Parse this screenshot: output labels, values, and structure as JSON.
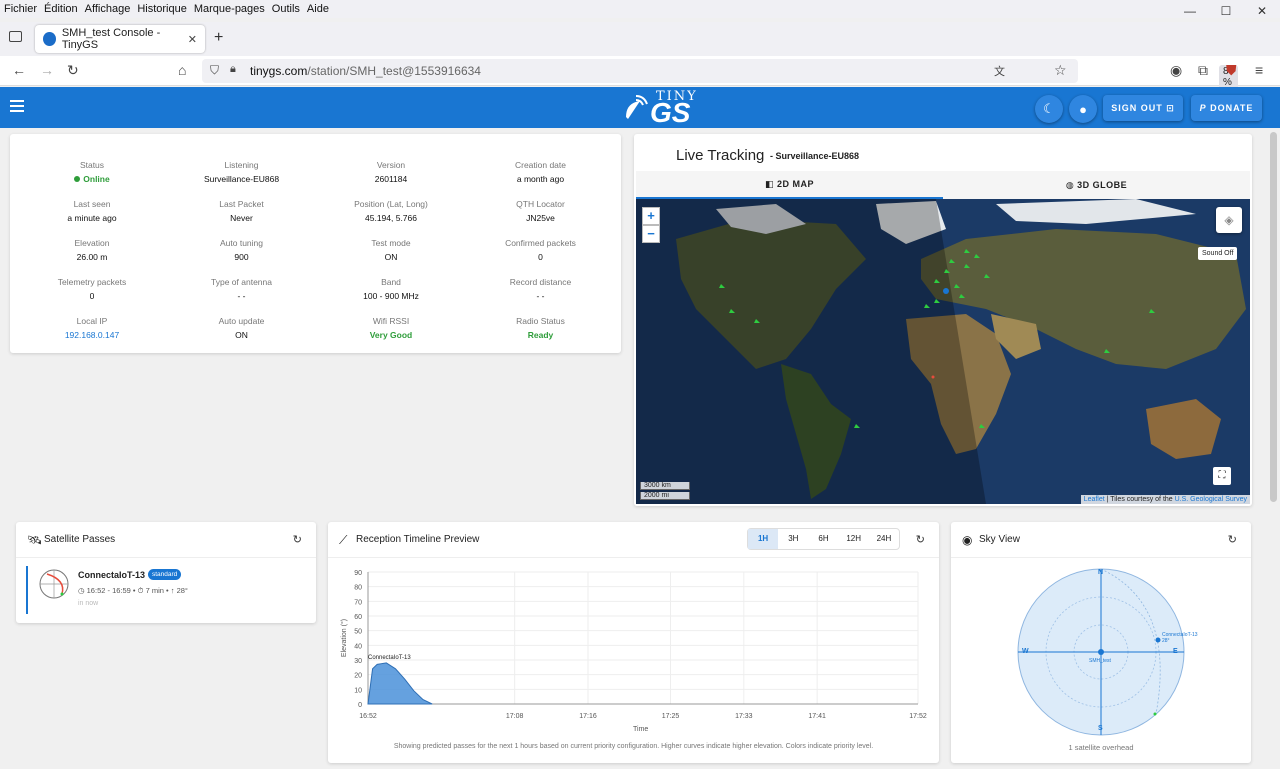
{
  "menubar": {
    "items": [
      "Fichier",
      "Édition",
      "Affichage",
      "Historique",
      "Marque-pages",
      "Outils",
      "Aide"
    ]
  },
  "window_controls": {
    "minimize": "—",
    "maximize": "☐",
    "close": "✕"
  },
  "browser": {
    "tab_title": "SMH_test Console - TinyGS",
    "url_domain": "tinygs.com",
    "url_path": "/station/SMH_test@1553916634",
    "zoom": "80 %"
  },
  "appbar": {
    "logo_top": "TINY",
    "logo_main": "GS",
    "sign_out": "SIGN OUT",
    "donate": "DONATE",
    "accent": "#1976d2"
  },
  "stats": [
    {
      "label": "Status",
      "value": "Online",
      "style": "green",
      "dot": true
    },
    {
      "label": "Listening",
      "value": "Surveillance-EU868"
    },
    {
      "label": "Version",
      "value": "2601184"
    },
    {
      "label": "Creation date",
      "value": "a month ago"
    },
    {
      "label": "Last seen",
      "value": "a minute ago"
    },
    {
      "label": "Last Packet",
      "value": "Never"
    },
    {
      "label": "Position (Lat, Long)",
      "value": "45.194, 5.766"
    },
    {
      "label": "QTH Locator",
      "value": "JN25ve"
    },
    {
      "label": "Elevation",
      "value": "26.00 m"
    },
    {
      "label": "Auto tuning",
      "value": "900"
    },
    {
      "label": "Test mode",
      "value": "ON"
    },
    {
      "label": "Confirmed packets",
      "value": "0"
    },
    {
      "label": "Telemetry packets",
      "value": "0"
    },
    {
      "label": "Type of antenna",
      "value": "- -"
    },
    {
      "label": "Band",
      "value": "100 - 900 MHz"
    },
    {
      "label": "Record distance",
      "value": "- -"
    },
    {
      "label": "Local IP",
      "value": "192.168.0.147",
      "style": "blue"
    },
    {
      "label": "Auto update",
      "value": "ON"
    },
    {
      "label": "Wifi RSSI",
      "value": "Very Good",
      "style": "green"
    },
    {
      "label": "Radio Status",
      "value": "Ready",
      "style": "green"
    }
  ],
  "tracking": {
    "title": "Live Tracking",
    "subtitle": "- Surveillance-EU868",
    "tab_map": "2D MAP",
    "tab_globe": "3D GLOBE",
    "zoom_in": "+",
    "zoom_out": "−",
    "sound": "Sound Off",
    "scale_km": "3000 km",
    "scale_mi": "2000 mi",
    "attrib_leaflet": "Leaflet",
    "attrib_text": "| Tiles courtesy of the",
    "attrib_usgs": "U.S. Geological Survey"
  },
  "passes": {
    "title": "Satellite Passes",
    "sat_name": "ConnectaIoT-13",
    "badge": "standard",
    "time": "16:52 - 16:59",
    "duration": "7 min",
    "max_elev": "28°",
    "eta": "in now"
  },
  "timeline": {
    "title": "Reception Timeline Preview",
    "ranges": [
      "1H",
      "3H",
      "6H",
      "12H",
      "24H"
    ],
    "selected_range": "1H",
    "footer": "Showing predicted passes for the next 1 hours based on current priority configuration. Higher curves indicate higher elevation. Colors indicate priority level."
  },
  "chart_data": {
    "type": "area",
    "xlabel": "Time",
    "ylabel": "Elevation (°)",
    "ylim": [
      0,
      90
    ],
    "yticks": [
      0,
      10,
      20,
      30,
      40,
      50,
      60,
      70,
      80,
      90
    ],
    "xticks": [
      "16:52",
      "17:08",
      "17:16",
      "17:25",
      "17:33",
      "17:41",
      "17:52"
    ],
    "grid": true,
    "series": [
      {
        "name": "ConnectaIoT-13",
        "color": "#4a90d9",
        "x_minutes": [
          0,
          0.5,
          1,
          2,
          3,
          4,
          5,
          6,
          7
        ],
        "y": [
          0,
          24,
          27,
          28,
          24,
          17,
          9,
          3,
          0
        ]
      }
    ]
  },
  "sky": {
    "title": "Sky View",
    "n": "N",
    "s": "S",
    "e": "E",
    "w": "W",
    "station": "SMH_test",
    "sat_label": "ConnectaIoT-13",
    "sat_elev": "28°",
    "footer": "1 satellite overhead"
  }
}
